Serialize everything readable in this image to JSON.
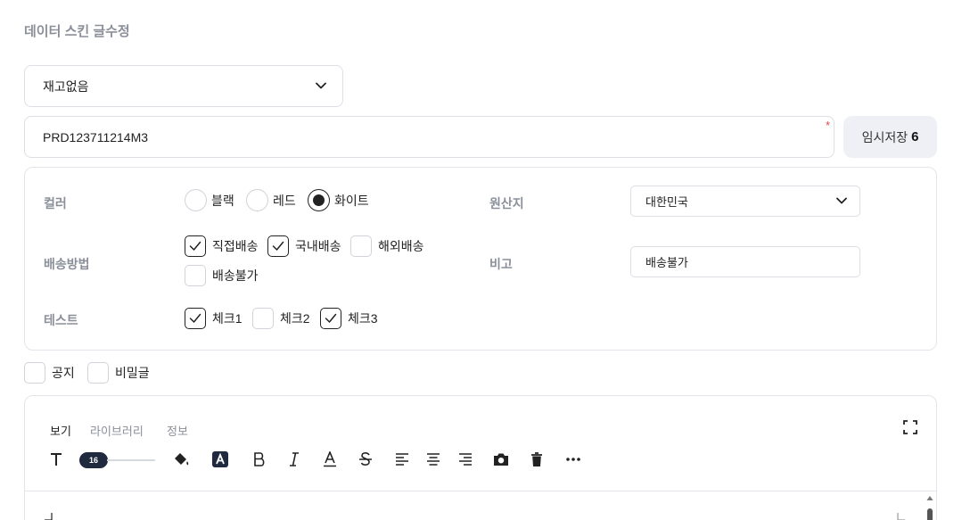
{
  "page": {
    "title": "데이터 스킨 글수정"
  },
  "stock_select": {
    "value": "재고없음",
    "icon": "chevron-down-icon"
  },
  "product_code": {
    "value": "PRD123711214M3",
    "required_mark": "*"
  },
  "temp_save": {
    "label": "임시저장",
    "count": "6"
  },
  "options": {
    "color": {
      "label": "컬러",
      "choices": [
        {
          "label": "블랙",
          "checked": false
        },
        {
          "label": "레드",
          "checked": false
        },
        {
          "label": "화이트",
          "checked": true
        }
      ]
    },
    "origin": {
      "label": "원산지",
      "value": "대한민국"
    },
    "shipping": {
      "label": "배송방법",
      "choices": [
        {
          "label": "직접배송",
          "checked": true
        },
        {
          "label": "국내배송",
          "checked": true
        },
        {
          "label": "해외배송",
          "checked": false
        },
        {
          "label": "배송불가",
          "checked": false
        }
      ]
    },
    "note": {
      "label": "비고",
      "value": "배송불가"
    },
    "test": {
      "label": "테스트",
      "choices": [
        {
          "label": "체크1",
          "checked": true
        },
        {
          "label": "체크2",
          "checked": false
        },
        {
          "label": "체크3",
          "checked": true
        }
      ]
    }
  },
  "flags": [
    {
      "label": "공지",
      "checked": false
    },
    {
      "label": "비밀글",
      "checked": false
    }
  ],
  "editor": {
    "tabs": [
      "보기",
      "라이브러리",
      "정보"
    ],
    "active_tab": "보기",
    "font_size": "16",
    "toolbar_icons": [
      "text-icon",
      "font-size-slider",
      "paint-bucket-icon",
      "highlight-icon",
      "bold-icon",
      "italic-icon",
      "underline-icon",
      "strikethrough-icon",
      "align-left-icon",
      "align-center-icon",
      "align-right-icon",
      "camera-icon",
      "trash-icon",
      "more-icon"
    ],
    "colors": {
      "accent": "#1f2a3f",
      "border": "#e3e5ea"
    }
  }
}
